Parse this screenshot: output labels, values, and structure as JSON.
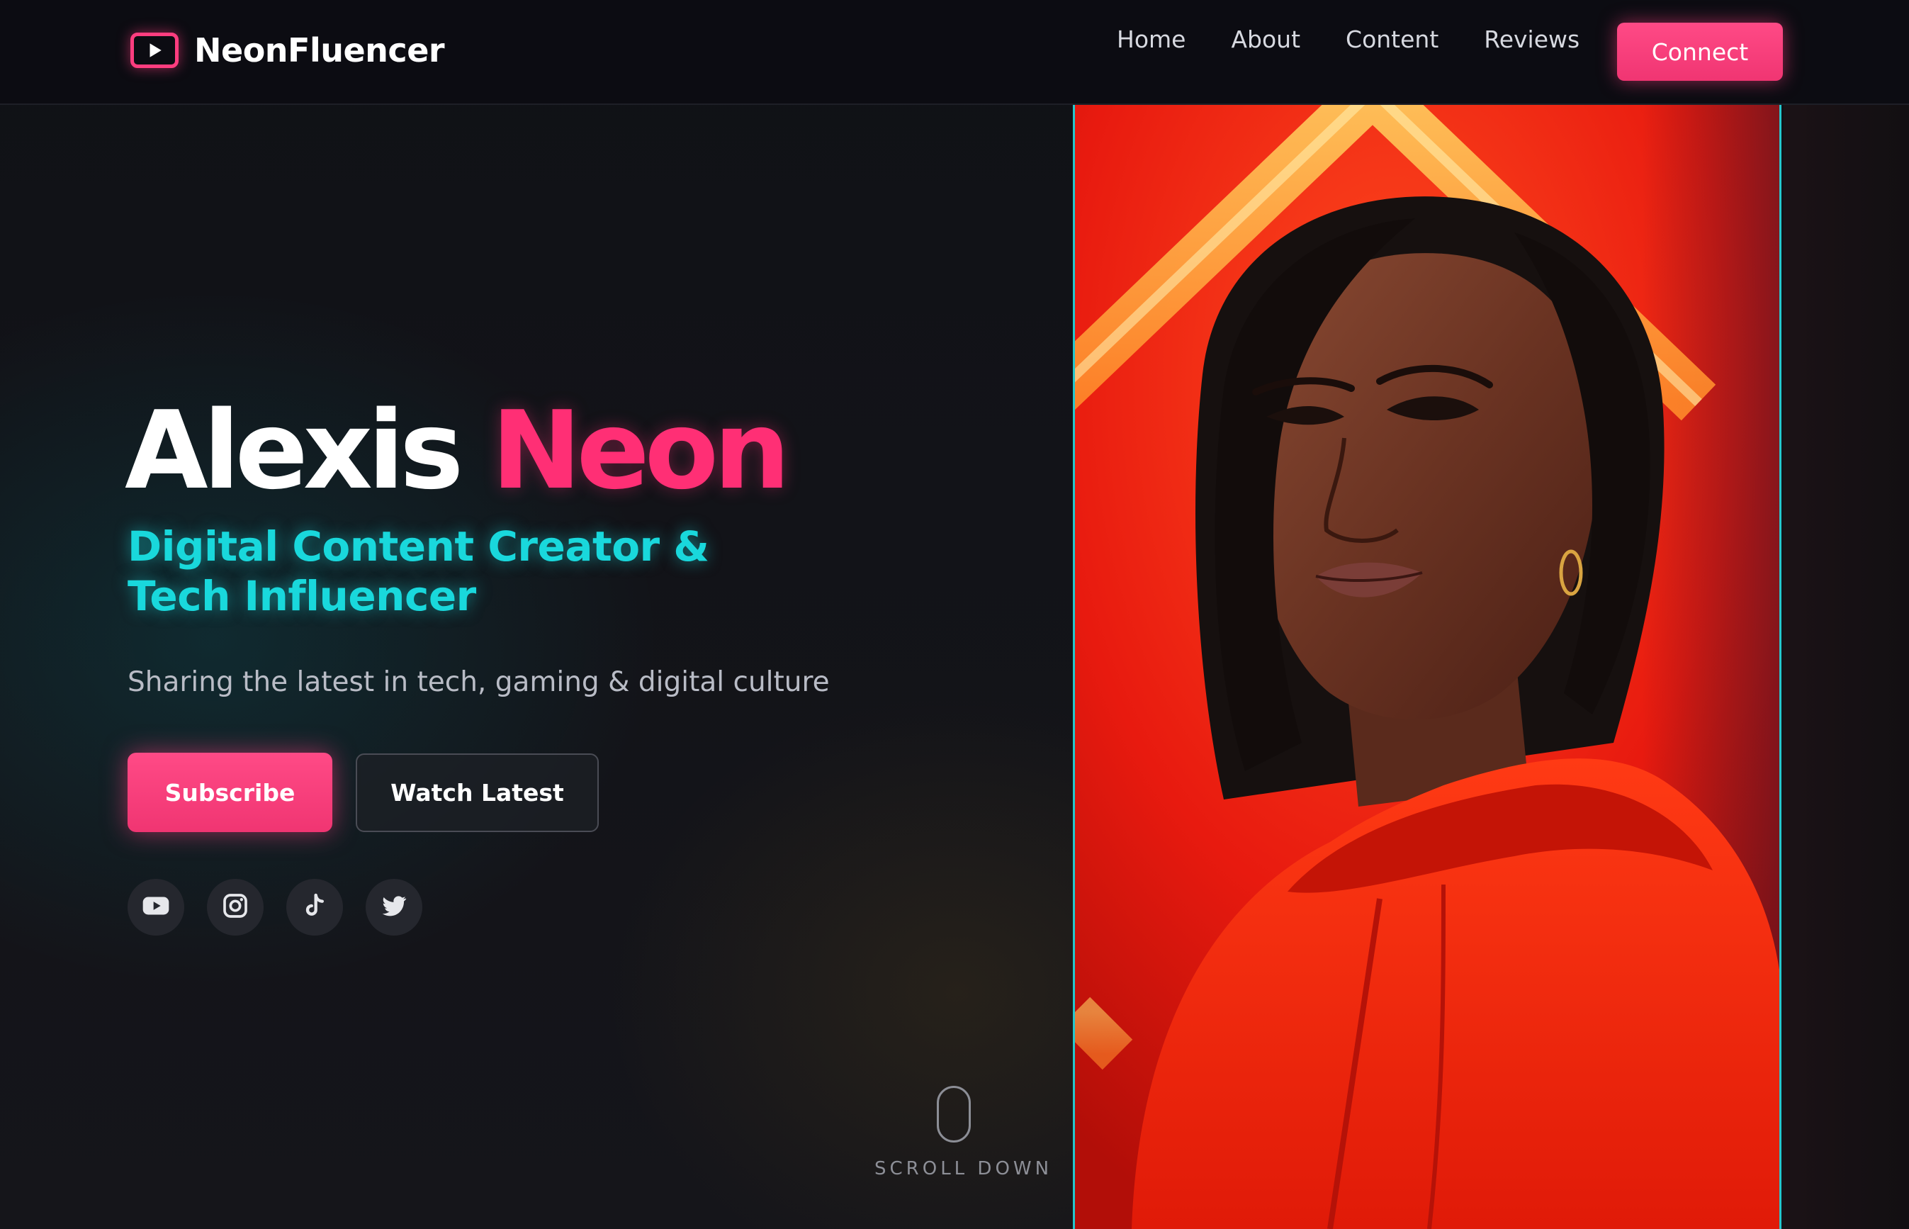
{
  "brand": {
    "name": "NeonFluencer",
    "icon": "play-icon"
  },
  "nav": {
    "items": [
      "Home",
      "About",
      "Content",
      "Reviews"
    ],
    "connect_label": "Connect"
  },
  "hero": {
    "first_name": "Alexis",
    "last_name": "Neon",
    "subtitle": "Digital Content Creator & Tech Influencer",
    "tagline": "Sharing the latest in tech, gaming & digital culture",
    "subscribe_label": "Subscribe",
    "watch_label": "Watch Latest"
  },
  "socials": [
    {
      "name": "youtube-icon"
    },
    {
      "name": "instagram-icon"
    },
    {
      "name": "tiktok-icon"
    },
    {
      "name": "twitter-icon"
    }
  ],
  "scroll": {
    "label": "SCROLL DOWN"
  },
  "colors": {
    "accent_pink": "#ff2f75",
    "accent_cyan": "#19d8dc",
    "background": "#101116",
    "portrait_red": "#e51b10"
  }
}
